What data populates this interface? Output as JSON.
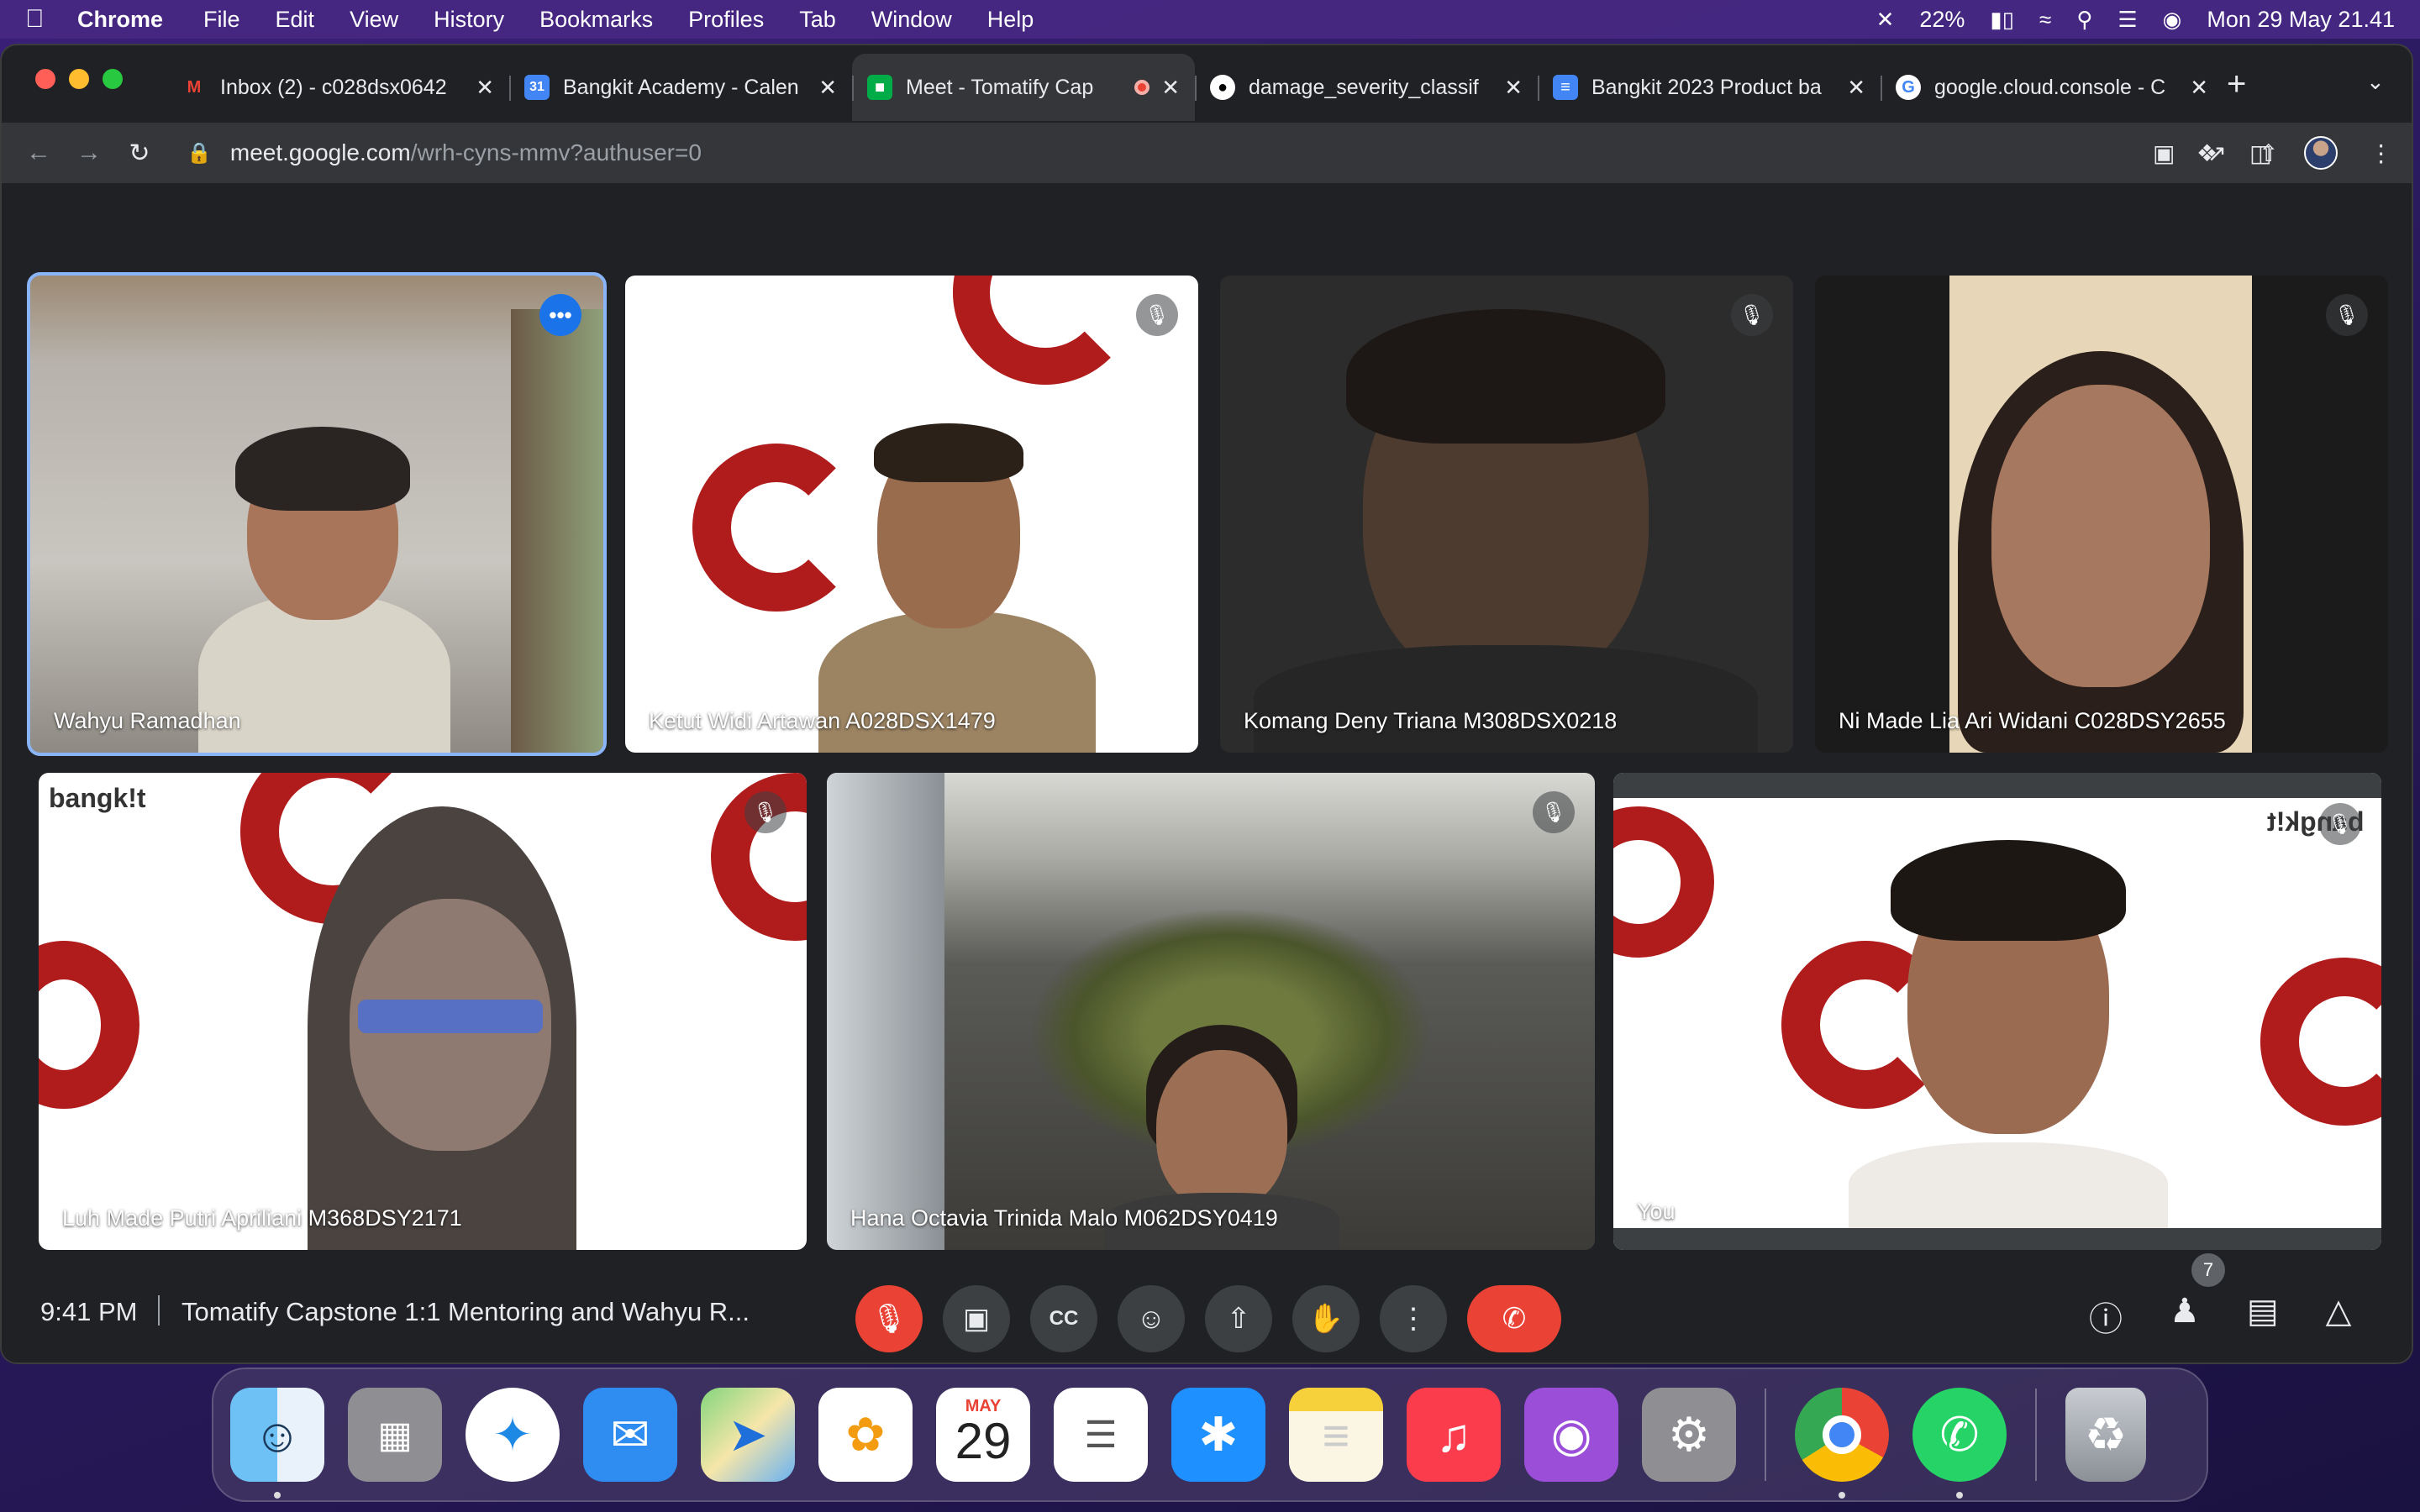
{
  "menubar": {
    "app": "Chrome",
    "items": [
      "File",
      "Edit",
      "View",
      "History",
      "Bookmarks",
      "Profiles",
      "Tab",
      "Window",
      "Help"
    ],
    "battery": "22%",
    "datetime": "Mon 29 May  21.41"
  },
  "tabs": [
    {
      "title": "Inbox (2) - c028dsx0642",
      "favicon": "gmail-icon",
      "color": "#ea4335"
    },
    {
      "title": "Bangkit Academy - Calen",
      "favicon": "calendar-icon",
      "color": "#4285f4"
    },
    {
      "title": "Meet - Tomatify Cap",
      "favicon": "meet-icon",
      "color": "#00ac47",
      "active": true,
      "recording": true
    },
    {
      "title": "damage_severity_classif",
      "favicon": "github-icon",
      "color": "#ffffff"
    },
    {
      "title": "Bangkit 2023 Product ba",
      "favicon": "docs-icon",
      "color": "#4285f4"
    },
    {
      "title": "google.cloud.console - C",
      "favicon": "google-icon",
      "color": "#ffffff"
    }
  ],
  "address": {
    "host": "meet.google.com",
    "path": "/wrh-cyns-mmv?authuser=0"
  },
  "participants": [
    {
      "name": "Wahyu Ramadhan",
      "speaking": true,
      "muted": false
    },
    {
      "name": "Ketut Widi Artawan A028DSX1479",
      "muted": true
    },
    {
      "name": "Komang Deny Triana M308DSX0218",
      "muted": true
    },
    {
      "name": "Ni Made Lia Ari Widani C028DSY2655",
      "muted": true
    },
    {
      "name": "Luh Made Putri Apriliani M368DSY2171",
      "muted": true
    },
    {
      "name": "Hana Octavia Trinida Malo M062DSY0419",
      "muted": true
    },
    {
      "name": "You",
      "muted": true
    }
  ],
  "bangkit_logo": "bangk!t",
  "bottombar": {
    "time": "9:41 PM",
    "title": "Tomatify Capstone 1:1 Mentoring and Wahyu R...",
    "people_count": "7"
  },
  "dock": {
    "calendar_month": "MAY",
    "calendar_day": "29",
    "apps": [
      "Finder",
      "Launchpad",
      "Safari",
      "Mail",
      "Maps",
      "Photos",
      "Calendar",
      "Reminders",
      "App Store",
      "Notes",
      "Music",
      "Podcasts",
      "System Settings",
      "Chrome",
      "WhatsApp",
      "Trash"
    ]
  }
}
